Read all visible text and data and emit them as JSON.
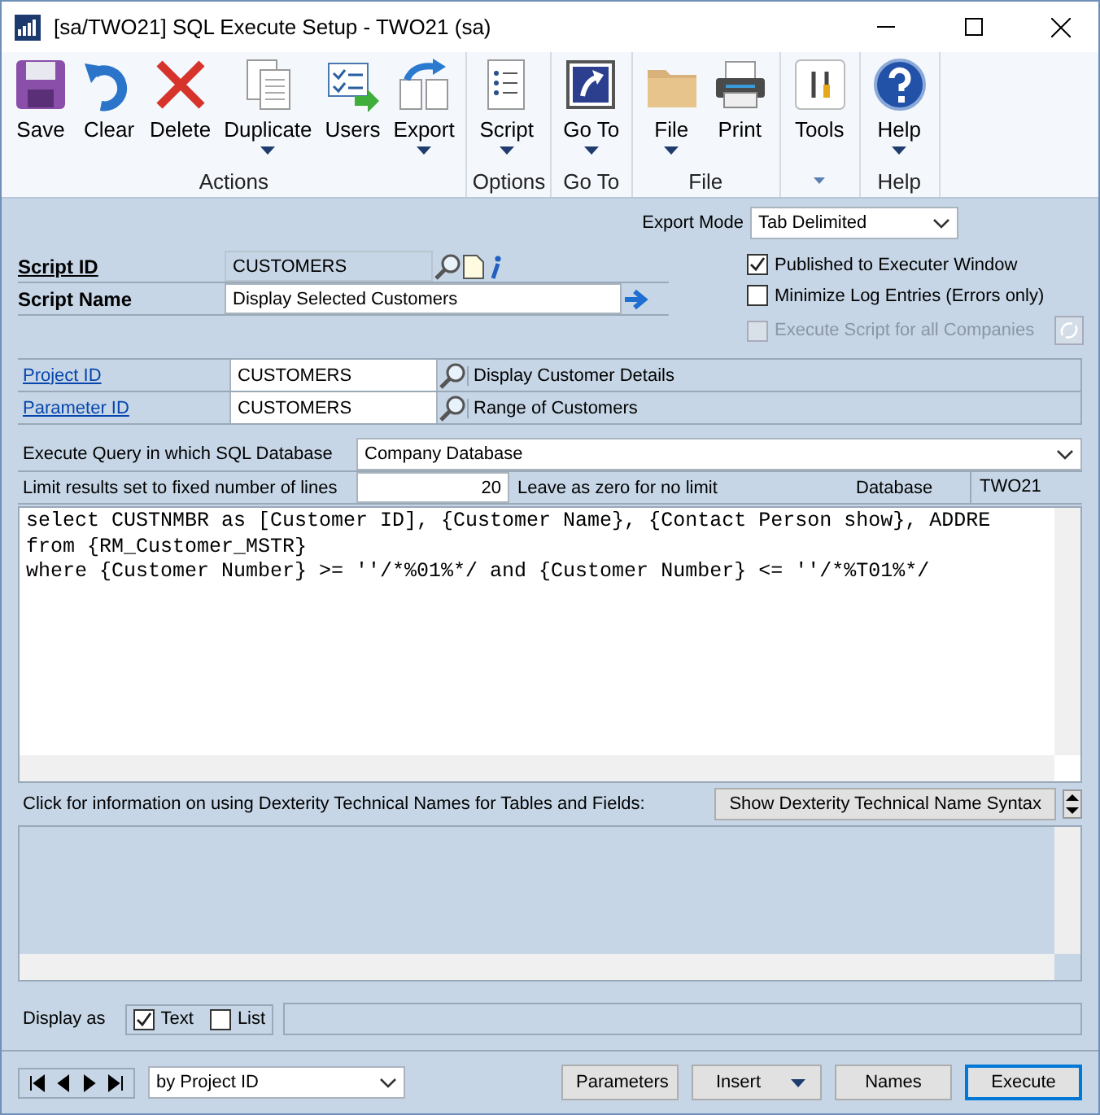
{
  "window": {
    "title": "[sa/TWO21] SQL Execute Setup  -  TWO21 (sa)"
  },
  "ribbon": {
    "groups": [
      {
        "label": "Actions",
        "launcher": false,
        "buttons": [
          {
            "label": "Save",
            "dropdown": false
          },
          {
            "label": "Clear",
            "dropdown": false
          },
          {
            "label": "Delete",
            "dropdown": false
          },
          {
            "label": "Duplicate",
            "dropdown": true
          },
          {
            "label": "Users",
            "dropdown": false
          },
          {
            "label": "Export",
            "dropdown": true
          }
        ]
      },
      {
        "label": "Options",
        "launcher": false,
        "buttons": [
          {
            "label": "Script",
            "dropdown": true
          }
        ]
      },
      {
        "label": "Go To",
        "launcher": false,
        "buttons": [
          {
            "label": "Go To",
            "dropdown": true
          }
        ]
      },
      {
        "label": "File",
        "launcher": false,
        "buttons": [
          {
            "label": "File",
            "dropdown": true
          },
          {
            "label": "Print",
            "dropdown": false
          }
        ]
      },
      {
        "launcher": true,
        "buttons": [
          {
            "label": "Tools",
            "dropdown": false
          }
        ]
      },
      {
        "label": "Help",
        "launcher": false,
        "buttons": [
          {
            "label": "Help",
            "dropdown": true
          }
        ]
      }
    ]
  },
  "export_mode": {
    "label": "Export Mode",
    "value": "Tab Delimited"
  },
  "script_id": {
    "label": "Script ID",
    "value": "CUSTOMERS"
  },
  "script_name": {
    "label": "Script Name",
    "value": "Display Selected Customers"
  },
  "options": [
    {
      "label": "Published to Executer Window",
      "checked": true,
      "disabled": false
    },
    {
      "label": "Minimize Log Entries (Errors only)",
      "checked": false,
      "disabled": false
    },
    {
      "label": "Execute Script for all Companies",
      "checked": false,
      "disabled": true
    }
  ],
  "project": {
    "label": "Project ID",
    "value": "CUSTOMERS",
    "description": "Display Customer Details"
  },
  "parameter": {
    "label": "Parameter ID",
    "value": "CUSTOMERS",
    "description": "Range of Customers"
  },
  "database_query": {
    "label": "Execute Query in which SQL Database",
    "value": "Company Database"
  },
  "limit": {
    "label": "Limit results set to fixed number of lines",
    "value": "20",
    "hint": "Leave as zero for no limit",
    "database_label": "Database",
    "database_value": "TWO21"
  },
  "query_lines": [
    "select CUSTNMBR as [Customer ID], {Customer Name}, {Contact Person show}, ADDRE",
    "from {RM_Customer_MSTR}",
    "where {Customer Number} >= ''/*%01%*/ and {Customer Number} <= ''/*%T01%*/"
  ],
  "help_text": "Click for information on using Dexterity Technical Names for Tables and Fields:",
  "syntax_button": "Show Dexterity Technical Name Syntax",
  "display_as": {
    "label": "Display as",
    "options": [
      {
        "label": "Text",
        "checked": true
      },
      {
        "label": "List",
        "checked": false
      }
    ]
  },
  "footer": {
    "sort_value": "by Project ID",
    "buttons": [
      {
        "label": "Parameters",
        "kind": "button",
        "default": false
      },
      {
        "label": "Insert",
        "kind": "split",
        "default": false
      },
      {
        "label": "Names",
        "kind": "button",
        "default": false
      },
      {
        "label": "Execute",
        "kind": "button",
        "default": true
      }
    ]
  }
}
